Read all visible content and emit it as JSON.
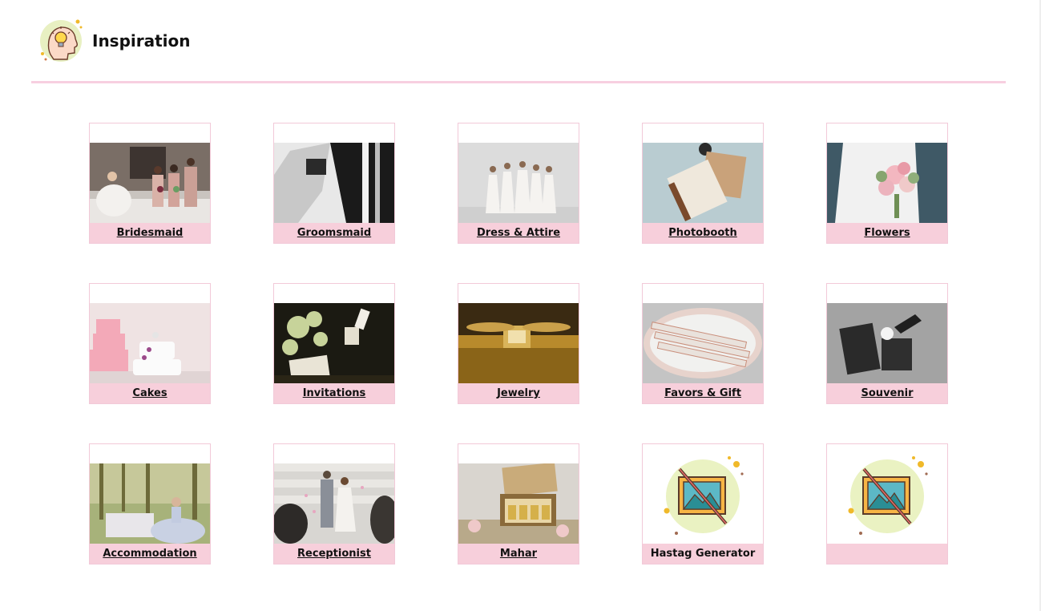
{
  "header": {
    "title": "Inspiration",
    "icon": "lightbulb-head-icon"
  },
  "colors": {
    "accent": "#f7cfdb",
    "divider": "#f7cfe0",
    "card_border": "#f2c9d8"
  },
  "cards": [
    {
      "label": "Bridesmaid",
      "image": "bridesmaids-photo"
    },
    {
      "label": "Groomsmaid",
      "image": "groom-cufflink-photo"
    },
    {
      "label": "Dress & Attire",
      "image": "bridal-party-dresses-photo"
    },
    {
      "label": "Photobooth",
      "image": "photo-album-photo"
    },
    {
      "label": "Flowers",
      "image": "bridal-bouquet-photo"
    },
    {
      "label": "Cakes",
      "image": "wedding-cakes-photo"
    },
    {
      "label": "Invitations",
      "image": "invitation-cards-photo"
    },
    {
      "label": "Jewelry",
      "image": "gold-ring-box-photo"
    },
    {
      "label": "Favors & Gift",
      "image": "gift-favors-tray-photo"
    },
    {
      "label": "Souvenir",
      "image": "souvenir-cards-photo"
    },
    {
      "label": "Accommodation",
      "image": "forest-bride-photo"
    },
    {
      "label": "Receptionist",
      "image": "couple-confetti-photo"
    },
    {
      "label": "Mahar",
      "image": "mahar-gold-box-photo"
    },
    {
      "label": "Hastag Generator",
      "image": "no-image-placeholder-icon"
    },
    {
      "label": "",
      "image": "no-image-placeholder-icon"
    }
  ]
}
